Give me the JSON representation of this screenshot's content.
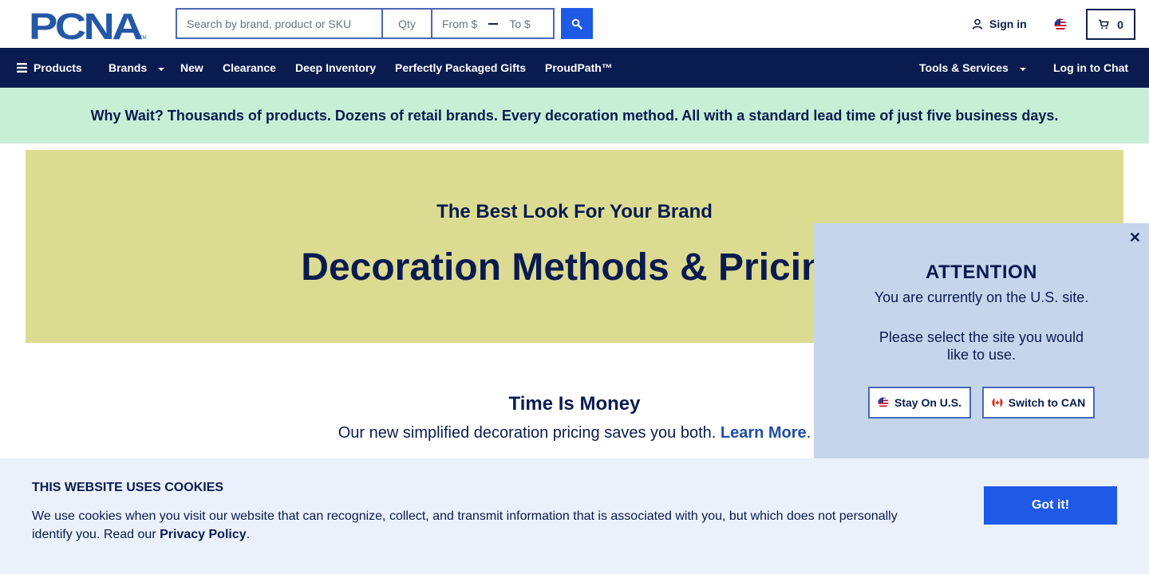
{
  "header": {
    "logo_text": "PCNA",
    "search": {
      "placeholder": "Search by brand, product or SKU",
      "qty_placeholder": "Qty",
      "from_label": "From $",
      "to_label": "To $"
    },
    "sign_in_label": "Sign in",
    "cart_count": "0"
  },
  "nav": {
    "products_label": "Products",
    "brands_label": "Brands",
    "new_label": "New",
    "clearance_label": "Clearance",
    "deep_inventory_label": "Deep Inventory",
    "gifts_label": "Perfectly Packaged Gifts",
    "proudpath_label": "ProudPath™",
    "tools_label": "Tools & Services",
    "chat_label": "Log in to Chat"
  },
  "promo": {
    "text": "Why Wait? Thousands of products. Dozens of retail brands. Every decoration method. All with a standard lead time of just five business days."
  },
  "hero": {
    "subtitle": "The Best Look For Your Brand",
    "title": "Decoration Methods & Pricing"
  },
  "time_section": {
    "title": "Time Is Money",
    "text": "Our new simplified decoration pricing saves you both.",
    "link_label": "Learn More",
    "trailing": "."
  },
  "modal": {
    "close_label": "✕",
    "title": "ATTENTION",
    "message": "You are currently on the U.S. site.",
    "prompt": "Please select the site you would like to use.",
    "stay_label": "Stay On U.S.",
    "switch_label": "Switch to CAN"
  },
  "cookie": {
    "title": "THIS WEBSITE USES COOKIES",
    "text": "We use cookies when you visit our website that can recognize, collect, and transmit information that is associated with you, but which does not personally identify you. Read our",
    "link_label": "Privacy Policy",
    "trailing": ".",
    "button_label": "Got it!"
  },
  "colors": {
    "navy": "#0a1b4f",
    "accent_blue": "#1f5ae6",
    "promo_bg": "#c6efd6",
    "hero_bg": "#dcdb92",
    "modal_bg": "#c5d5ec",
    "cookie_bg": "#eaf1fb"
  }
}
